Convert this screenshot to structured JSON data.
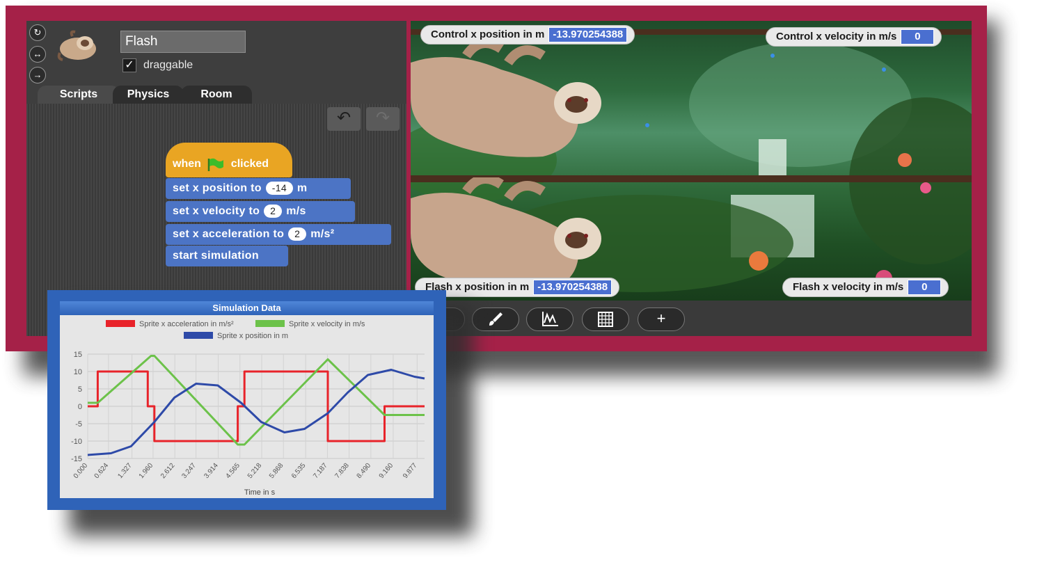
{
  "sprite": {
    "name": "Flash",
    "draggable_label": "draggable",
    "draggable_checked": true
  },
  "tabs": [
    "Scripts",
    "Physics",
    "Room"
  ],
  "ide_buttons": {
    "undo_icon": "undo-arrow-icon",
    "redo_icon": "redo-arrow-icon"
  },
  "blocks": {
    "hat": {
      "when": "when",
      "clicked": "clicked",
      "icon": "green-flag-icon"
    },
    "set_position": {
      "label": "set x position to",
      "value": "-14",
      "unit": "m"
    },
    "set_velocity": {
      "label": "set x velocity to",
      "value": "2",
      "unit": "m/s"
    },
    "set_acceleration": {
      "label": "set x acceleration to",
      "value": "2",
      "unit": "m/s²"
    },
    "start": {
      "label": "start simulation"
    }
  },
  "watchers": {
    "control_position": {
      "label": "Control x position in m",
      "value": "-13.970254388"
    },
    "control_velocity": {
      "label": "Control x velocity in m/s",
      "value": "0"
    },
    "flash_position": {
      "label": "Flash x position in m",
      "value": "-13.970254388"
    },
    "flash_velocity": {
      "label": "Flash x velocity in m/s",
      "value": "0"
    }
  },
  "stage_toolbar": [
    "paint-brush-icon",
    "graph-icon",
    "table-grid-icon",
    "plus-icon"
  ],
  "colors": {
    "frame": "#a52148",
    "acceleration": "#e8232a",
    "velocity": "#6cc24a",
    "position": "#2e4aa8",
    "block": "#4c74c5",
    "hat": "#e9a523"
  },
  "chart_data": {
    "type": "line",
    "title": "Simulation Data",
    "xlabel": "Time in s",
    "ylabel": "",
    "ylim": [
      -15,
      15
    ],
    "yticks": [
      "15",
      "10",
      "5",
      "0",
      "-5",
      "-10",
      "-15"
    ],
    "x_tick_labels": [
      "0.000",
      "0.624",
      "1.327",
      "1.960",
      "2.612",
      "3.247",
      "3.914",
      "4.565",
      "5.218",
      "5.868",
      "6.535",
      "7.187",
      "7.838",
      "8.490",
      "9.160",
      "9.877"
    ],
    "legend_placement": "top",
    "grid": true,
    "series": [
      {
        "name": "Sprite x acceleration in m/s²",
        "color": "#e8232a",
        "x": [
          0,
          0.3,
          0.3,
          1.8,
          1.8,
          2.0,
          2.0,
          4.5,
          4.5,
          4.7,
          4.7,
          7.2,
          7.2,
          8.9,
          8.9,
          10.1
        ],
        "y": [
          0,
          0,
          10,
          10,
          0,
          0,
          -10,
          -10,
          0,
          0,
          10,
          10,
          -10,
          -10,
          0,
          0
        ]
      },
      {
        "name": "Sprite x velocity in m/s",
        "color": "#6cc24a",
        "x": [
          0,
          0.3,
          1.9,
          2.0,
          4.5,
          4.7,
          7.2,
          8.9,
          10.1
        ],
        "y": [
          1,
          1,
          14.5,
          14.5,
          -11,
          -11,
          13.5,
          -2.5,
          -2.5
        ]
      },
      {
        "name": "Sprite x position in m",
        "color": "#2e4aa8",
        "x": [
          0,
          0.7,
          1.3,
          2.0,
          2.6,
          3.25,
          3.9,
          4.6,
          5.2,
          5.9,
          6.5,
          7.2,
          7.8,
          8.4,
          9.1,
          9.8,
          10.1
        ],
        "y": [
          -14,
          -13.5,
          -11.5,
          -4.5,
          2.5,
          6.5,
          6.0,
          1.0,
          -4.5,
          -7.5,
          -6.5,
          -2.0,
          4.0,
          9.0,
          10.5,
          8.5,
          8.0
        ]
      }
    ]
  }
}
